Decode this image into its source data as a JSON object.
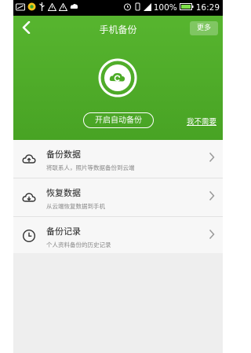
{
  "status_bar": {
    "battery_percent": "100%",
    "time": "16:29"
  },
  "header": {
    "title": "手机备份",
    "more_label": "更多",
    "back_icon": "chevron-left-icon"
  },
  "hero": {
    "logo_icon": "cloud-backup-icon",
    "auto_backup_label": "开启自动备份",
    "no_need_label": "我不需要"
  },
  "list": {
    "items": [
      {
        "title": "备份数据",
        "subtitle": "将联系人，照片等数据备份到云端",
        "icon": "cloud-upload-icon"
      },
      {
        "title": "恢复数据",
        "subtitle": "从云端恢复数据到手机",
        "icon": "cloud-download-icon"
      },
      {
        "title": "备份记录",
        "subtitle": "个人资料备份的历史记录",
        "icon": "clock-icon"
      }
    ]
  },
  "colors": {
    "brand_green": "#4cab27"
  }
}
